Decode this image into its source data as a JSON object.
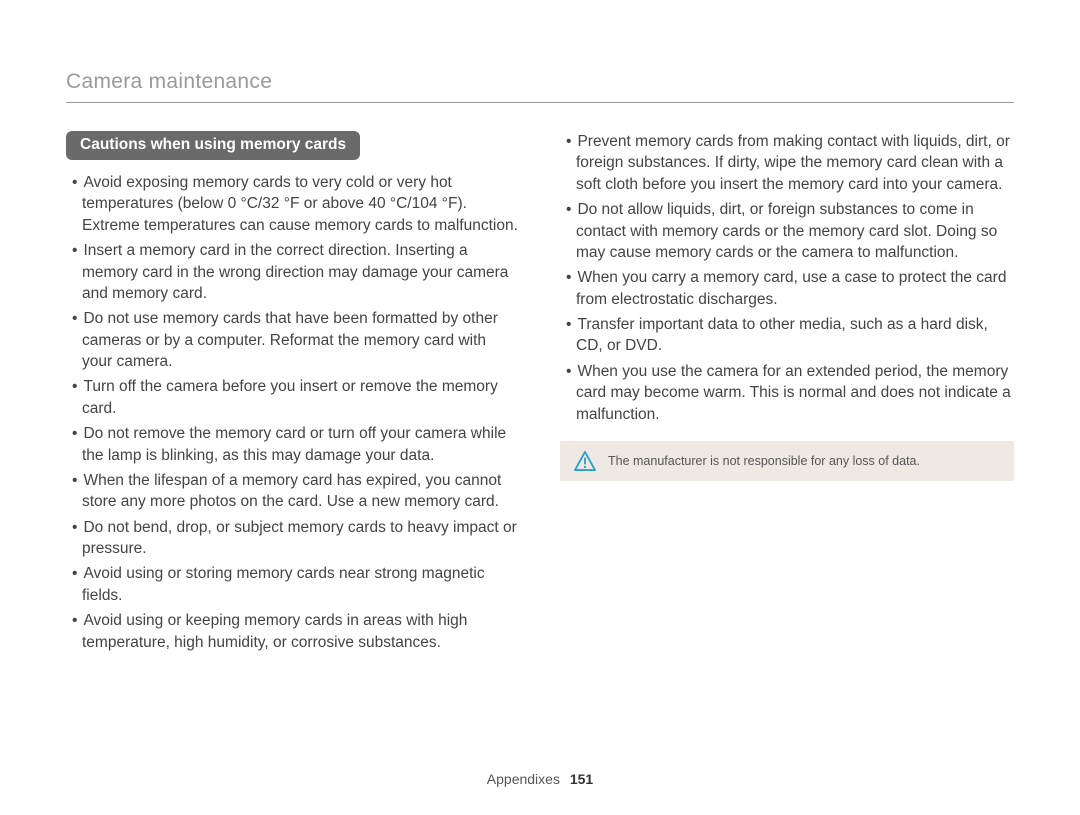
{
  "header_title": "Camera maintenance",
  "section_pill": "Cautions when using memory cards",
  "left_bullets": [
    "Avoid exposing memory cards to very cold or very hot temperatures (below 0 °C/32 °F or above 40 °C/104 °F). Extreme temperatures can cause memory cards to malfunction.",
    "Insert a memory card in the correct direction. Inserting a memory card in the wrong direction may damage your camera and memory card.",
    "Do not use memory cards that have been formatted by other cameras or by a computer. Reformat the memory card with your camera.",
    "Turn off the camera before you insert or remove the memory card.",
    "Do not remove the memory card or turn off your camera while the lamp is blinking, as this may damage your data.",
    "When the lifespan of a memory card has expired, you cannot store any more photos on the card. Use a new memory card.",
    "Do not bend, drop, or subject memory cards to heavy impact or pressure.",
    "Avoid using or storing memory cards near strong magnetic fields.",
    "Avoid using or keeping memory cards in areas with high temperature, high humidity, or corrosive substances."
  ],
  "right_bullets": [
    "Prevent memory cards from making contact with liquids, dirt, or foreign substances. If dirty, wipe the memory card clean with a soft cloth before you insert the memory card into your camera.",
    "Do not allow liquids, dirt, or foreign substances to come in contact with memory cards or the memory card slot. Doing so may cause memory cards or the camera to malfunction.",
    "When you carry a memory card, use a case to protect the card from electrostatic discharges.",
    "Transfer important data to other media, such as a hard disk, CD, or DVD.",
    "When you use the camera for an extended period, the memory card may become warm. This is normal and does not indicate a malfunction."
  ],
  "note_text": "The manufacturer is not responsible for any loss of data.",
  "footer_section": "Appendixes",
  "footer_page": "151"
}
